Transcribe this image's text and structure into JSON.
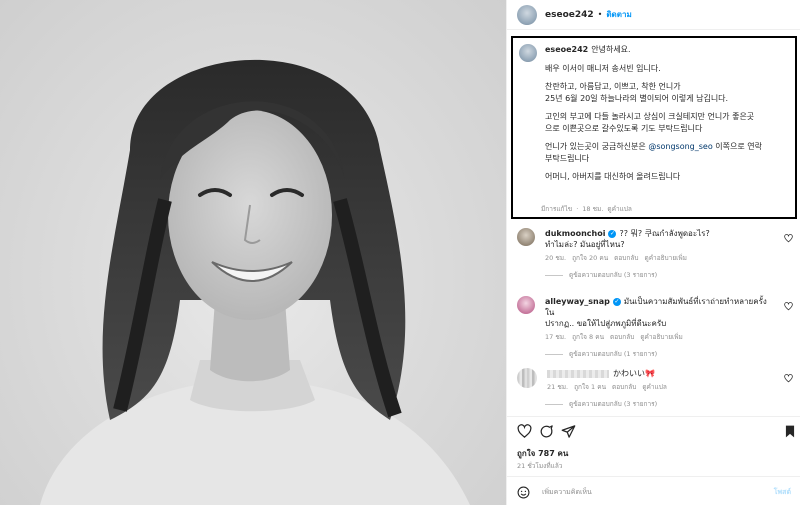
{
  "header": {
    "username": "eseoe242",
    "separator": "•",
    "follow_label": "ติดตาม"
  },
  "caption": {
    "username": "eseoe242",
    "lines": [
      "안녕하세요.",
      "배우 이서이 매니저 송서빈 입니다.",
      "찬란하고, 아름답고, 이쁘고, 착한 언니가",
      "25년 6월 20일 하늘나라의 별이되어 이렇게 남깁니다.",
      "고인의 부고에 다들 놀라시고 상심이 크실테지만 언니가 좋은곳",
      "으로 이쁜곳으로 갈수있도록 기도 부탁드립니다",
      "언니가 있는곳이 궁금하신분은",
      "@songsong_seo",
      "이쪽으로 연락",
      "부탁드립니다",
      "어머니, 아버지를 대신하여 올려드립니다"
    ],
    "edited": "มีการแก้ไข",
    "time": "18 ชม.",
    "translate": "ดูคำแปล"
  },
  "comments": [
    {
      "username": "dukmoonchoi",
      "text1": "?? 뭐? 쿠ณกำลังพูดอะไร?",
      "text2": "ทำไมล่ะ? มันอยู่ที่ไหน?",
      "time": "20 ชม.",
      "likes": "ถูกใจ 20 คน",
      "reply": "ตอบกลับ",
      "extra": "ดูคำอธิบายเพิ่ม",
      "replies": "ดูข้อความตอบกลับ (3 รายการ)"
    },
    {
      "username": "alleyway_snap",
      "text1": "มันเป็นความสัมพันธ์ที่เราถ่ายทำหลายครั้งใน",
      "text2": "ปรากฏ.. ขอให้ไปสู่ภพภูมิที่ดีนะครับ",
      "time": "17 ชม.",
      "likes": "ถูกใจ 8 คน",
      "reply": "ตอบกลับ",
      "extra": "ดูคำอธิบายเพิ่ม",
      "replies": "ดูข้อความตอบกลับ (1 รายการ)"
    },
    {
      "username": "",
      "text1": "かわいい",
      "time": "21 ชม.",
      "likes": "ถูกใจ 1 คน",
      "reply": "ตอบกลับ",
      "extra": "ดูคำแปล",
      "replies": "ดูข้อความตอบกลับ (3 รายการ)"
    }
  ],
  "likes_count": "ถูกใจ 787 คน",
  "posted_ago": "21 ชั่วโมงที่แล้ว",
  "add_comment": {
    "placeholder": "เพิ่มความคิดเห็น",
    "post_label": "โพสต์"
  },
  "colors": {
    "link": "#0095f6",
    "mention": "#00376b",
    "meta": "#8e8e8e",
    "highlight_border": "#000000"
  },
  "icons": [
    "heart-icon",
    "comment-icon",
    "share-icon",
    "bookmark-icon",
    "emoji-icon",
    "verified-icon"
  ]
}
